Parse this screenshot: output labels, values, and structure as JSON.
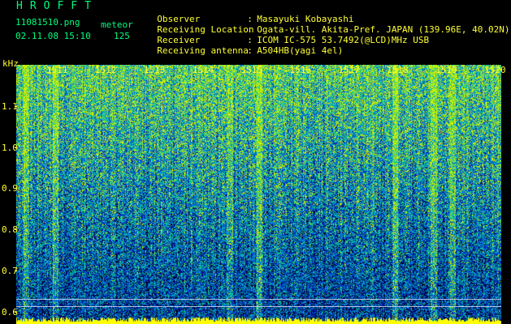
{
  "header": {
    "title": "HROFFT",
    "filename": "11081510.png",
    "datetime": "02.11.08 15:10",
    "meteor_label": "meteor",
    "meteor_count": "125"
  },
  "station_info": [
    {
      "key": "Observer",
      "sep": ":",
      "value": "Masayuki Kobayashi"
    },
    {
      "key": "Receiving Location",
      "sep": ":",
      "value": "Ogata-vill. Akita-Pref. JAPAN (139.96E, 40.02N)"
    },
    {
      "key": "Receiver",
      "sep": ":",
      "value": "ICOM IC-575 53.7492(@LCD)MHz USB"
    },
    {
      "key": "Receiving antenna",
      "sep": ":",
      "value": "A504HB(yagi 4el)"
    }
  ],
  "chart_data": {
    "type": "heatmap",
    "ylabel": "kHz",
    "y_ticks": [
      "1.1",
      "1.0",
      "0.9",
      "0.8",
      "0.7",
      "0.6"
    ],
    "x_ticks": [
      "1511",
      "1512",
      "1513",
      "1514",
      "1515",
      "1516",
      "1517",
      "1518",
      "1519",
      "1520"
    ],
    "ylim": [
      0.57,
      1.2
    ],
    "colormap": [
      "#000080",
      "#0030c0",
      "#0070e0",
      "#00b0c0",
      "#20d080",
      "#d0f000"
    ],
    "baseline_color": "#ffff00"
  }
}
